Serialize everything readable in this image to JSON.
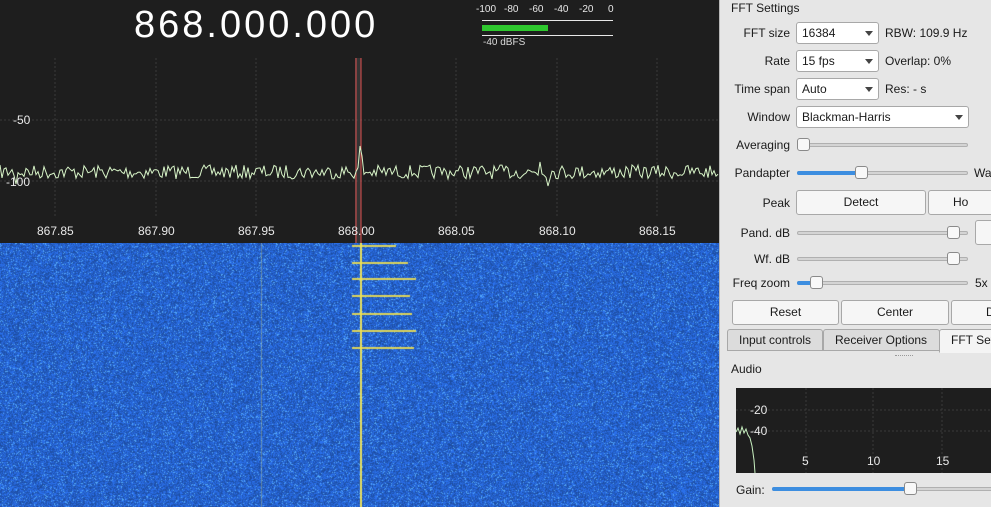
{
  "frequency": "868.000.000",
  "smeter": {
    "ticks": [
      "-100",
      "-80",
      "-60",
      "-40",
      "-20",
      "0"
    ],
    "level_text": "-40 dBFS",
    "level_fraction": 0.5
  },
  "pandapter": {
    "y_labels": [
      "-50",
      "-100"
    ],
    "x_labels": [
      "867.85",
      "867.90",
      "867.95",
      "868.00",
      "868.05",
      "868.10",
      "868.15"
    ]
  },
  "fft": {
    "title": "FFT Settings",
    "fft_size_label": "FFT size",
    "fft_size_value": "16384",
    "rbw": "RBW: 109.9 Hz",
    "rate_label": "Rate",
    "rate_value": "15 fps",
    "overlap": "Overlap: 0%",
    "timespan_label": "Time span",
    "timespan_value": "Auto",
    "res": "Res: - s",
    "window_label": "Window",
    "window_value": "Blackman-Harris",
    "averaging_label": "Averaging",
    "averaging_level": 0.0,
    "pandapter_label": "Pandapter",
    "pandapter_level": 0.37,
    "pandapter_right": "Wa",
    "peak_label": "Peak",
    "detect_button": "Detect",
    "hold_button": "Ho",
    "pand_db_label": "Pand. dB",
    "pand_db_level": 0.95,
    "wf_db_label": "Wf. dB",
    "wf_db_level": 0.95,
    "freq_zoom_label": "Freq zoom",
    "freq_zoom_level": 0.08,
    "freq_zoom_value": "5x",
    "reset_button": "Reset",
    "center_button": "Center",
    "d_button": "D"
  },
  "tabs": [
    "Input controls",
    "Receiver Options",
    "FFT Set"
  ],
  "audio": {
    "title": "Audio",
    "y_labels": [
      "-20",
      "-40"
    ],
    "x_labels": [
      "5",
      "10",
      "15"
    ],
    "gain_label": "Gain:",
    "gain_level": 0.58
  },
  "colors": {
    "trace": "#d8f5c8",
    "marker": "#e05050",
    "waterfall_bg": "#3b6fd6",
    "accent": "#3d8ee0",
    "meter": "#2ec72e"
  }
}
